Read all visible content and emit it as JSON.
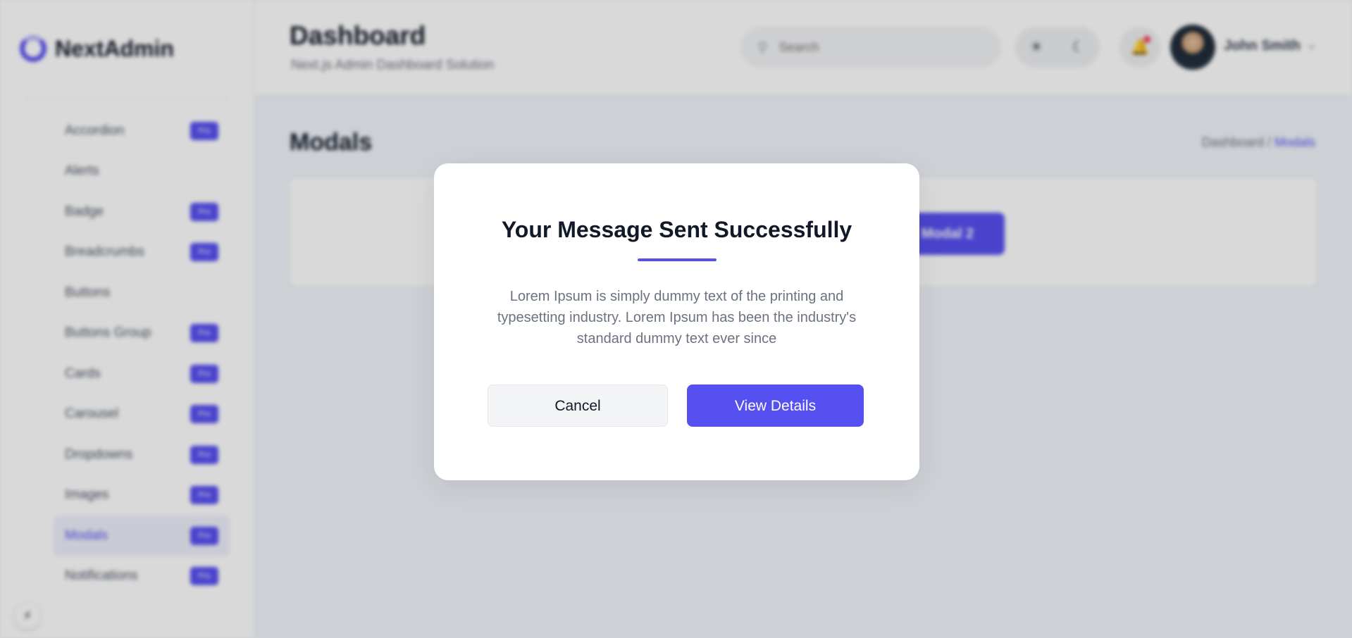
{
  "brand": {
    "name": "NextAdmin",
    "logo_icon": "ring-logo-icon"
  },
  "sidebar": {
    "items": [
      {
        "label": "Accordion",
        "badge": "Pro",
        "active": false
      },
      {
        "label": "Alerts",
        "badge": "",
        "active": false
      },
      {
        "label": "Badge",
        "badge": "Pro",
        "active": false
      },
      {
        "label": "Breadcrumbs",
        "badge": "Pro",
        "active": false
      },
      {
        "label": "Buttons",
        "badge": "",
        "active": false
      },
      {
        "label": "Buttons Group",
        "badge": "Pro",
        "active": false
      },
      {
        "label": "Cards",
        "badge": "Pro",
        "active": false
      },
      {
        "label": "Carousel",
        "badge": "Pro",
        "active": false
      },
      {
        "label": "Dropdowns",
        "badge": "Pro",
        "active": false
      },
      {
        "label": "Images",
        "badge": "Pro",
        "active": false
      },
      {
        "label": "Modals",
        "badge": "Pro",
        "active": true
      },
      {
        "label": "Notifications",
        "badge": "Pro",
        "active": false
      }
    ]
  },
  "header": {
    "title": "Dashboard",
    "subtitle": "Next.js Admin Dashboard Solution",
    "search_placeholder": "Search",
    "user_name": "John Smith"
  },
  "page": {
    "title": "Modals",
    "breadcrumb": {
      "home": "Dashboard",
      "separator": "/",
      "current": "Modals"
    },
    "open_button_label": "Modal 2"
  },
  "modal": {
    "title": "Your Message Sent Successfully",
    "body": "Lorem Ipsum is simply dummy text of the printing and typesetting industry. Lorem Ipsum has been the industry's standard dummy text ever since",
    "cancel_label": "Cancel",
    "confirm_label": "View Details"
  },
  "icons": {
    "search": "search-icon",
    "theme_toggle": [
      "sun-icon",
      "moon-icon"
    ],
    "notifications": "bell-icon",
    "dropdown": "chevron-down-icon",
    "fab": "lightning-icon"
  },
  "colors": {
    "primary": "#5750f1",
    "overlay": "rgba(0,0,0,0.15)",
    "text_dark": "#111827",
    "text_muted": "#6b7280"
  }
}
